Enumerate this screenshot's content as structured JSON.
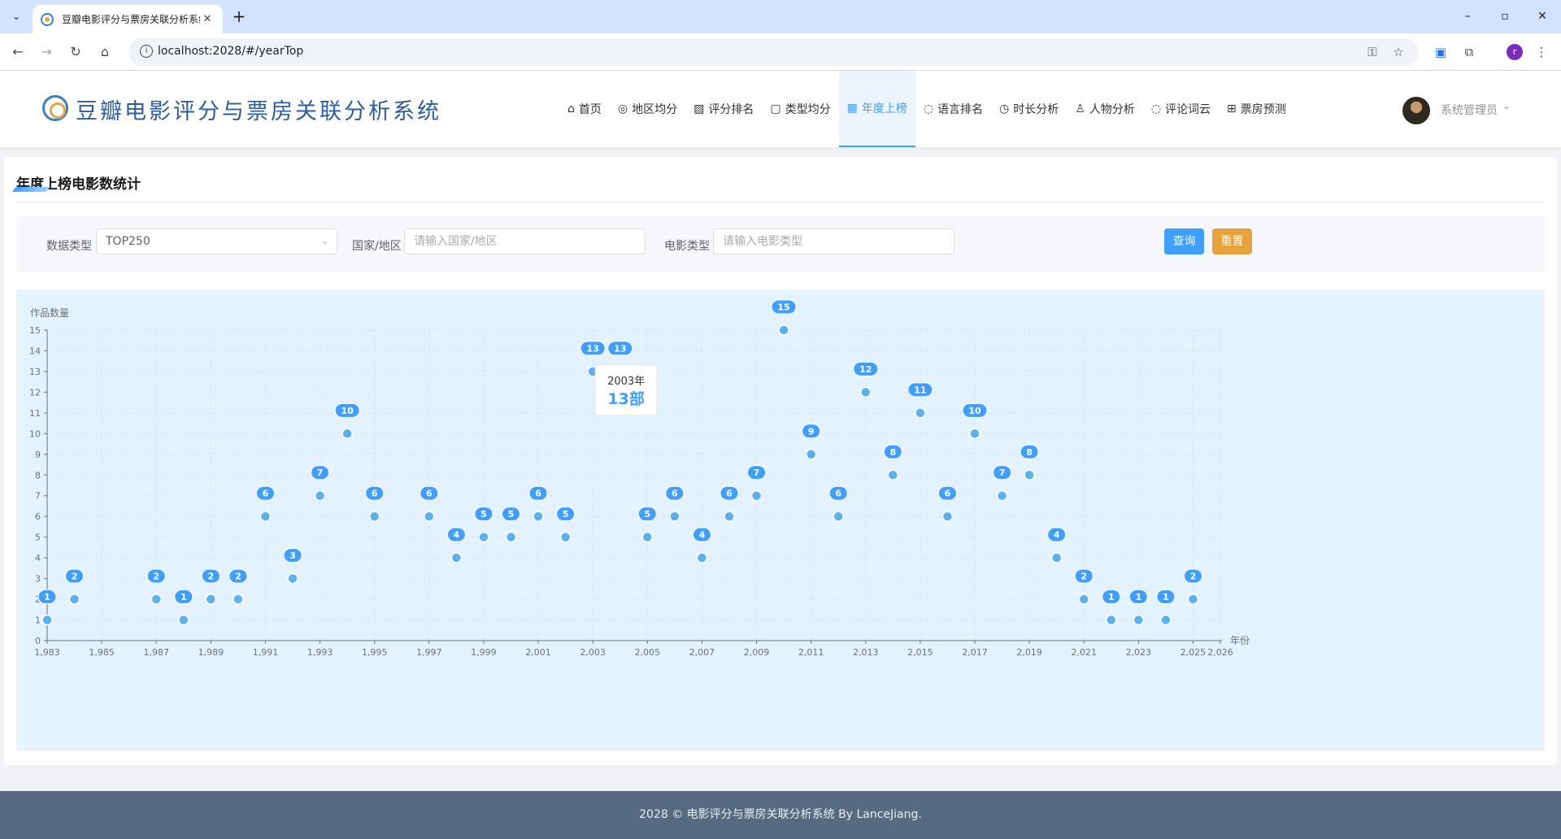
{
  "browser": {
    "tab_title": "豆瓣电影评分与票房关联分析系统",
    "url": "localhost:2028/#/yearTop",
    "profile_initial": "r"
  },
  "header": {
    "brand": "豆瓣电影评分与票房关联分析系统",
    "menu": [
      {
        "icon": "home-icon",
        "glyph": "⌂",
        "label": "首页"
      },
      {
        "icon": "location-icon",
        "glyph": "◎",
        "label": "地区均分"
      },
      {
        "icon": "trend-chart-icon",
        "glyph": "▨",
        "label": "评分排名"
      },
      {
        "icon": "notebook-icon",
        "glyph": "▢",
        "label": "类型均分"
      },
      {
        "icon": "calendar-icon",
        "glyph": "▦",
        "label": "年度上榜",
        "active": true
      },
      {
        "icon": "chat-icon",
        "glyph": "◌",
        "label": "语言排名"
      },
      {
        "icon": "stopwatch-icon",
        "glyph": "◷",
        "label": "时长分析"
      },
      {
        "icon": "user-icon",
        "glyph": "♙",
        "label": "人物分析"
      },
      {
        "icon": "comment-icon",
        "glyph": "◌",
        "label": "评论词云"
      },
      {
        "icon": "cart-icon",
        "glyph": "⊞",
        "label": "票房预测"
      }
    ],
    "user_name": "系统管理员"
  },
  "main": {
    "title": "年度上榜电影数统计",
    "filters": {
      "data_type_label": "数据类型",
      "data_type_value": "TOP250",
      "region_label": "国家/地区",
      "region_placeholder": "请输入国家/地区",
      "genre_label": "电影类型",
      "genre_placeholder": "请输入电影类型",
      "query_button": "查询",
      "reset_button": "重置"
    },
    "tooltip": {
      "year": "2003年",
      "value": "13部"
    }
  },
  "chart_data": {
    "type": "scatter",
    "ylabel": "作品数量",
    "xlabel": "年份",
    "ylim": [
      0,
      15
    ],
    "xlim": [
      1983,
      2026
    ],
    "x_ticks": [
      "1,983",
      "1,985",
      "1,987",
      "1,989",
      "1,991",
      "1,993",
      "1,995",
      "1,997",
      "1,999",
      "2,001",
      "2,003",
      "2,005",
      "2,007",
      "2,009",
      "2,011",
      "2,013",
      "2,015",
      "2,017",
      "2,019",
      "2,021",
      "2,023",
      "2,025",
      "2,026"
    ],
    "y_ticks": [
      "0",
      "1",
      "2",
      "3",
      "4",
      "5",
      "6",
      "7",
      "8",
      "9",
      "10",
      "11",
      "12",
      "13",
      "14",
      "15"
    ],
    "points": [
      {
        "x": 1983,
        "y": 1
      },
      {
        "x": 1984,
        "y": 2
      },
      {
        "x": 1987,
        "y": 2
      },
      {
        "x": 1988,
        "y": 1
      },
      {
        "x": 1989,
        "y": 2
      },
      {
        "x": 1990,
        "y": 2
      },
      {
        "x": 1991,
        "y": 6
      },
      {
        "x": 1992,
        "y": 3
      },
      {
        "x": 1993,
        "y": 7
      },
      {
        "x": 1994,
        "y": 10
      },
      {
        "x": 1995,
        "y": 6
      },
      {
        "x": 1997,
        "y": 6
      },
      {
        "x": 1998,
        "y": 4
      },
      {
        "x": 1999,
        "y": 5
      },
      {
        "x": 2000,
        "y": 5
      },
      {
        "x": 2001,
        "y": 6
      },
      {
        "x": 2002,
        "y": 5
      },
      {
        "x": 2003,
        "y": 13
      },
      {
        "x": 2004,
        "y": 13
      },
      {
        "x": 2005,
        "y": 5
      },
      {
        "x": 2006,
        "y": 6
      },
      {
        "x": 2007,
        "y": 4
      },
      {
        "x": 2008,
        "y": 6
      },
      {
        "x": 2009,
        "y": 7
      },
      {
        "x": 2010,
        "y": 15
      },
      {
        "x": 2011,
        "y": 9
      },
      {
        "x": 2012,
        "y": 6
      },
      {
        "x": 2013,
        "y": 12
      },
      {
        "x": 2014,
        "y": 8
      },
      {
        "x": 2015,
        "y": 11
      },
      {
        "x": 2016,
        "y": 6
      },
      {
        "x": 2017,
        "y": 10
      },
      {
        "x": 2018,
        "y": 7
      },
      {
        "x": 2019,
        "y": 8
      },
      {
        "x": 2020,
        "y": 4
      },
      {
        "x": 2021,
        "y": 2
      },
      {
        "x": 2022,
        "y": 1
      },
      {
        "x": 2023,
        "y": 1
      },
      {
        "x": 2024,
        "y": 1
      },
      {
        "x": 2025,
        "y": 2
      }
    ],
    "point_color": "#5ab1ef",
    "label_color": "#409eff",
    "grid": true
  },
  "footer": {
    "text": "2028 © 电影评分与票房关联分析系统 By LanceJiang."
  }
}
